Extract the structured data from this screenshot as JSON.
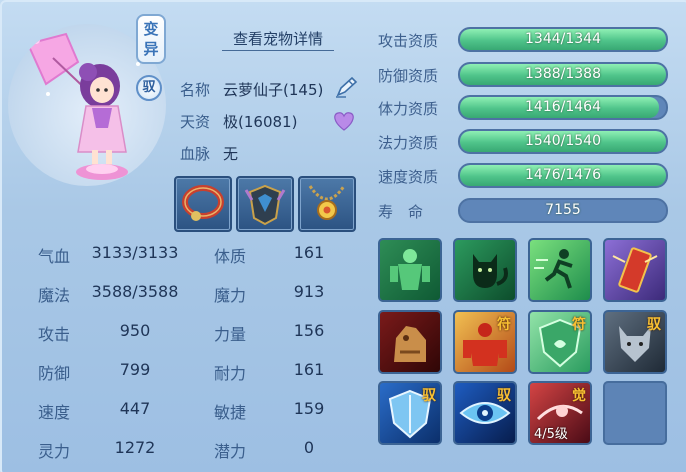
{
  "header": {
    "badge_transform": "变异",
    "badge_tamed": "驭",
    "detail_link": "查看宠物详情"
  },
  "pet": {
    "name_label": "名称",
    "name_value": "云萝仙子(145)",
    "aptitude_label": "天资",
    "aptitude_value": "极(16081)",
    "bloodline_label": "血脉",
    "bloodline_value": "无"
  },
  "equipment": [
    "collar-equipment",
    "armor-equipment",
    "pendant-equipment"
  ],
  "stats_left": [
    {
      "label": "气血",
      "value": "3133/3133"
    },
    {
      "label": "魔法",
      "value": "3588/3588"
    },
    {
      "label": "攻击",
      "value": "950"
    },
    {
      "label": "防御",
      "value": "799"
    },
    {
      "label": "速度",
      "value": "447"
    },
    {
      "label": "灵力",
      "value": "1272"
    }
  ],
  "stats_right": [
    {
      "label": "体质",
      "value": "161"
    },
    {
      "label": "魔力",
      "value": "913"
    },
    {
      "label": "力量",
      "value": "156"
    },
    {
      "label": "耐力",
      "value": "161"
    },
    {
      "label": "敏捷",
      "value": "159"
    },
    {
      "label": "潜力",
      "value": "0"
    }
  ],
  "aptitudes": [
    {
      "label": "攻击资质",
      "text": "1344/1344",
      "fill": 1.0
    },
    {
      "label": "防御资质",
      "text": "1388/1388",
      "fill": 1.0
    },
    {
      "label": "体力资质",
      "text": "1416/1464",
      "fill": 0.967
    },
    {
      "label": "法力资质",
      "text": "1540/1540",
      "fill": 1.0
    },
    {
      "label": "速度资质",
      "text": "1476/1476",
      "fill": 1.0
    }
  ],
  "lifespan": {
    "label": "寿　命",
    "value": "7155"
  },
  "skills": {
    "tag_fu": "符",
    "tag_yu": "驭",
    "tag_jue": "觉",
    "awaken_level": "4/5级"
  },
  "colors": {
    "accent": "#3a74b8",
    "bar_fill": "#4fc48a",
    "bar_empty": "#5f86b9",
    "skill_tag": "#f8c032"
  }
}
